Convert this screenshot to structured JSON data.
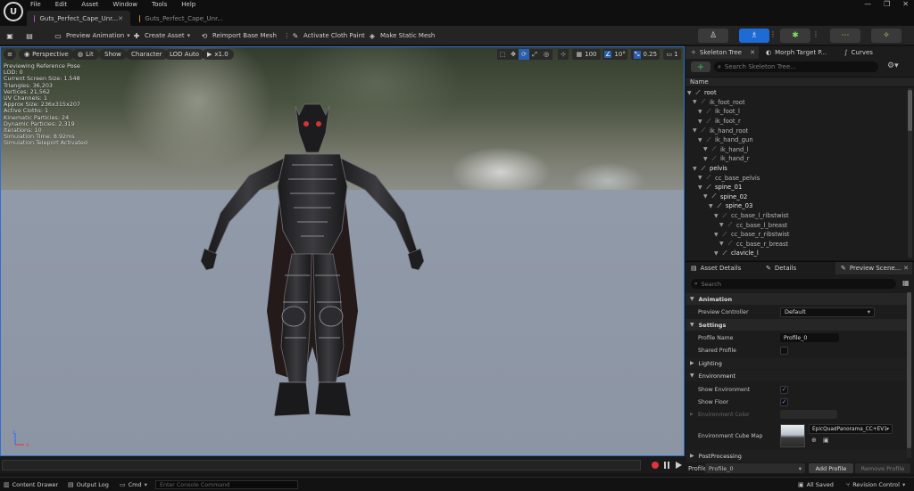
{
  "menu": [
    "File",
    "Edit",
    "Asset",
    "Window",
    "Tools",
    "Help"
  ],
  "tabs": [
    {
      "label": "Guts_Perfect_Cape_Unr...",
      "active": true
    },
    {
      "label": "Guts_Perfect_Cape_Unr...",
      "active": false
    }
  ],
  "toolbar": {
    "preview_animation": "Preview Animation",
    "create_asset": "Create Asset",
    "reimport": "Reimport Base Mesh",
    "cloth_paint": "Activate Cloth Paint",
    "static_mesh": "Make Static Mesh"
  },
  "viewport": {
    "perspective": "Perspective",
    "lit": "Lit",
    "show": "Show",
    "character": "Character",
    "lod": "LOD Auto",
    "speed": "x1.0",
    "grid_value": "100",
    "angle_value": "10°",
    "scale_value": "0.25",
    "camera_value": "1",
    "stats": [
      "Previewing Reference Pose",
      "LOD: 0",
      "Current Screen Size: 1.548",
      "Triangles: 36,203",
      "Vertices: 21,562",
      "UV Channels: 1",
      "Approx Size: 236x315x207",
      "Active Cloths: 1",
      "Kinematic Particles: 24",
      "Dynamic Particles: 2,319",
      "Iterations: 10",
      "Simulation Time: 8.92ms",
      "Simulation Teleport Activated"
    ]
  },
  "skeleton_panel": {
    "tabs": [
      "Skeleton Tree",
      "Morph Target P...",
      "Curves"
    ],
    "search_placeholder": "Search Skeleton Tree...",
    "header": "Name",
    "bones": [
      {
        "name": "root",
        "depth": 0,
        "solid": true
      },
      {
        "name": "ik_foot_root",
        "depth": 1,
        "solid": false
      },
      {
        "name": "ik_foot_l",
        "depth": 2,
        "solid": false
      },
      {
        "name": "ik_foot_r",
        "depth": 2,
        "solid": false
      },
      {
        "name": "ik_hand_root",
        "depth": 1,
        "solid": false
      },
      {
        "name": "ik_hand_gun",
        "depth": 2,
        "solid": false
      },
      {
        "name": "ik_hand_l",
        "depth": 3,
        "solid": false
      },
      {
        "name": "ik_hand_r",
        "depth": 3,
        "solid": false
      },
      {
        "name": "pelvis",
        "depth": 1,
        "solid": true
      },
      {
        "name": "cc_base_pelvis",
        "depth": 2,
        "solid": false
      },
      {
        "name": "spine_01",
        "depth": 2,
        "solid": true
      },
      {
        "name": "spine_02",
        "depth": 3,
        "solid": true
      },
      {
        "name": "spine_03",
        "depth": 4,
        "solid": true
      },
      {
        "name": "cc_base_l_ribstwist",
        "depth": 5,
        "solid": false
      },
      {
        "name": "cc_base_l_breast",
        "depth": 6,
        "solid": false
      },
      {
        "name": "cc_base_r_ribstwist",
        "depth": 5,
        "solid": false
      },
      {
        "name": "cc_base_r_breast",
        "depth": 6,
        "solid": false
      },
      {
        "name": "clavicle_l",
        "depth": 5,
        "solid": true
      }
    ]
  },
  "details_panel": {
    "tabs": [
      "Asset Details",
      "Details",
      "Preview Scene..."
    ],
    "search_placeholder": "Search",
    "sections": {
      "animation": "Animation",
      "settings": "Settings",
      "lighting": "Lighting",
      "environment": "Environment",
      "postprocessing": "PostProcessing"
    },
    "props": {
      "preview_controller_label": "Preview Controller",
      "preview_controller_value": "Default",
      "profile_name_label": "Profile Name",
      "profile_name_value": "Profile_0",
      "shared_profile_label": "Shared Profile",
      "show_env_label": "Show Environment",
      "show_floor_label": "Show Floor",
      "env_color_label": "Environment Color",
      "env_cube_label": "Environment Cube Map",
      "env_cube_value": "EpicQuadPanorama_CC+EV1"
    },
    "profile_bar": {
      "label": "Profile",
      "value": "Profile_0",
      "add": "Add Profile",
      "remove": "Remove Profile"
    }
  },
  "statusbar": {
    "content_drawer": "Content Drawer",
    "output_log": "Output Log",
    "cmd": "Cmd",
    "console_placeholder": "Enter Console Command",
    "all_saved": "All Saved",
    "revision": "Revision Control"
  }
}
